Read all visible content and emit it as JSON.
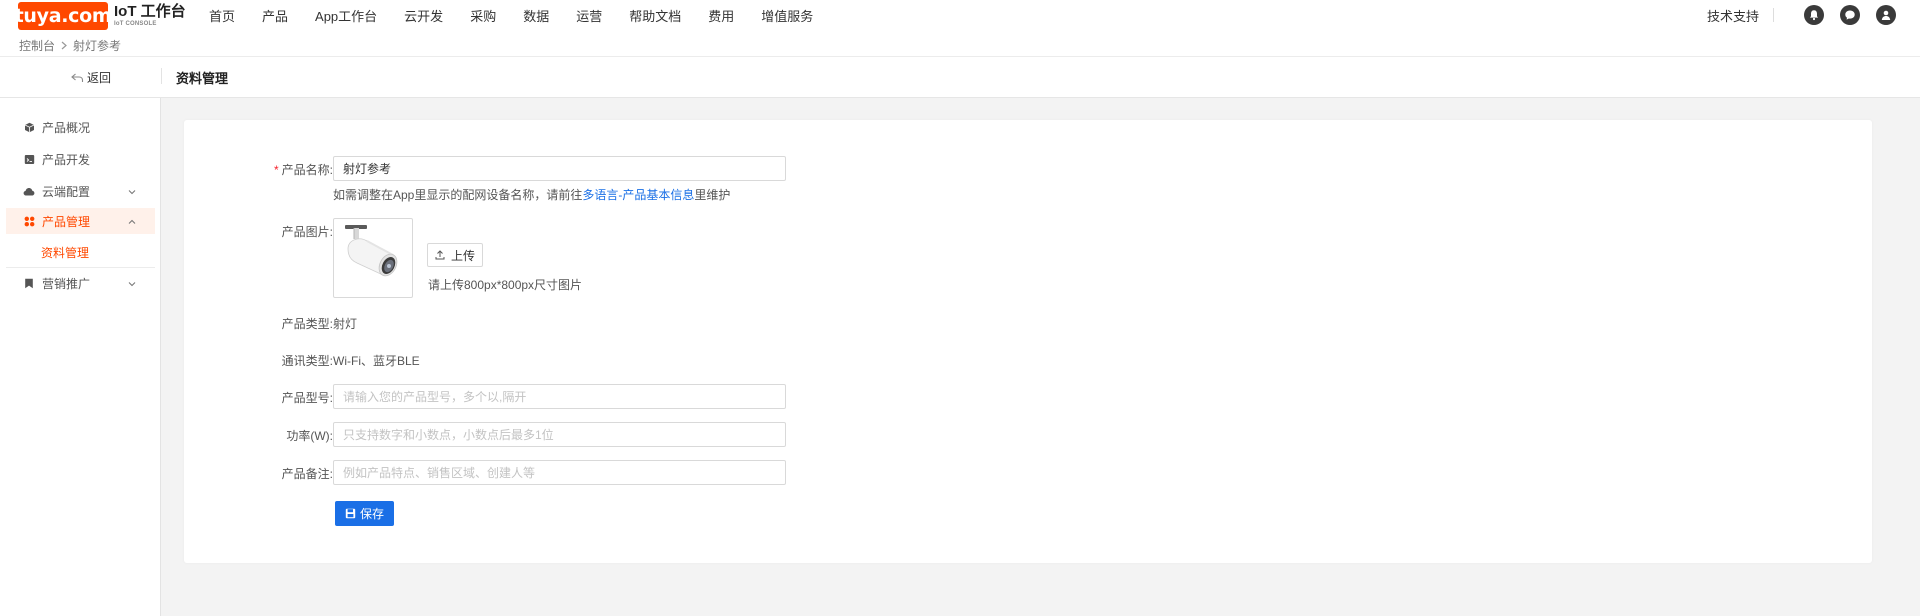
{
  "header": {
    "logo_text": "tuya.com",
    "brand_title": "IoT 工作台",
    "brand_subtitle": "IoT CONSOLE",
    "nav": [
      {
        "label": "首页"
      },
      {
        "label": "产品"
      },
      {
        "label": "App工作台"
      },
      {
        "label": "云开发"
      },
      {
        "label": "采购"
      },
      {
        "label": "数据"
      },
      {
        "label": "运营"
      },
      {
        "label": "帮助文档"
      },
      {
        "label": "费用"
      },
      {
        "label": "增值服务"
      }
    ],
    "breadcrumb": [
      "控制台",
      "射灯参考"
    ],
    "support_label": "技术支持",
    "icons": [
      "bell-icon",
      "message-icon",
      "user-icon"
    ],
    "brand_color": "#ff4800"
  },
  "subheader": {
    "back_label": "返回",
    "title": "资料管理"
  },
  "sidebar": {
    "items": [
      {
        "label": "产品概况",
        "icon": "box-icon"
      },
      {
        "label": "产品开发",
        "icon": "develop-icon"
      },
      {
        "label": "云端配置",
        "icon": "cloud-icon"
      },
      {
        "label": "产品管理",
        "icon": "grid-icon"
      },
      {
        "label": "营销推广",
        "icon": "bookmark-icon"
      }
    ],
    "active_sub": "资料管理",
    "active_color": "#ff4800"
  },
  "form": {
    "name_label": "产品名称:",
    "name_value": "射灯参考",
    "name_help_prefix": "如需调整在App里显示的配网设备名称，请前往",
    "name_help_link": "多语言-产品基本信息",
    "name_help_suffix": "里维护",
    "image_label": "产品图片:",
    "upload_label": "上传",
    "upload_hint": "请上传800px*800px尺寸图片",
    "type_label": "产品类型:",
    "type_value": "射灯",
    "comm_label": "通讯类型:",
    "comm_value": "Wi-Fi、蓝牙BLE",
    "model_label": "产品型号:",
    "model_placeholder": "请输入您的产品型号，多个以,隔开",
    "power_label": "功率(W):",
    "power_placeholder": "只支持数字和小数点，小数点后最多1位",
    "remark_label": "产品备注:",
    "remark_placeholder": "例如产品特点、销售区域、创建人等",
    "save_label": "保存",
    "primary_color": "#1a6fe6"
  }
}
